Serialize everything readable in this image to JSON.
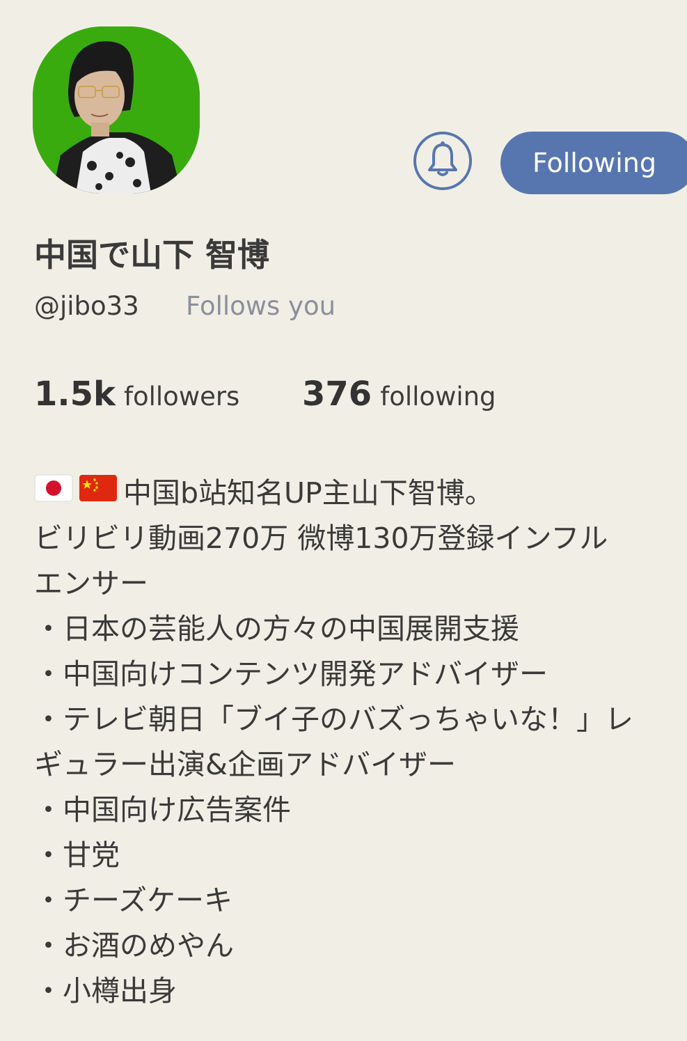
{
  "profile": {
    "name": "中国で山下 智博",
    "handle": "@jibo33",
    "follows_you": "Follows you",
    "follow_button_label": "Following",
    "bell_icon": "bell-icon"
  },
  "stats": {
    "followers_count": "1.5k",
    "followers_label": "followers",
    "following_count": "376",
    "following_label": "following"
  },
  "bio": {
    "flags": [
      "japan-flag-icon",
      "china-flag-icon"
    ],
    "lines": [
      "中国b站知名UP主山下智博。",
      "ビリビリ動画270万 微博130万登録インフル",
      "エンサー",
      "・日本の芸能人の方々の中国展開支援",
      "・中国向けコンテンツ開発アドバイザー",
      "・テレビ朝日「ブイ子のバズっちゃいな！」レ",
      "ギュラー出演&企画アドバイザー",
      "・中国向け広告案件",
      "・甘党",
      "・チーズケーキ",
      "・お酒のめやん",
      "・小樽出身"
    ]
  },
  "colors": {
    "background": "#F1EFE5",
    "accent": "#5776AF",
    "avatar_bg": "#3AAB0F",
    "muted_text": "#8A8F9C"
  }
}
